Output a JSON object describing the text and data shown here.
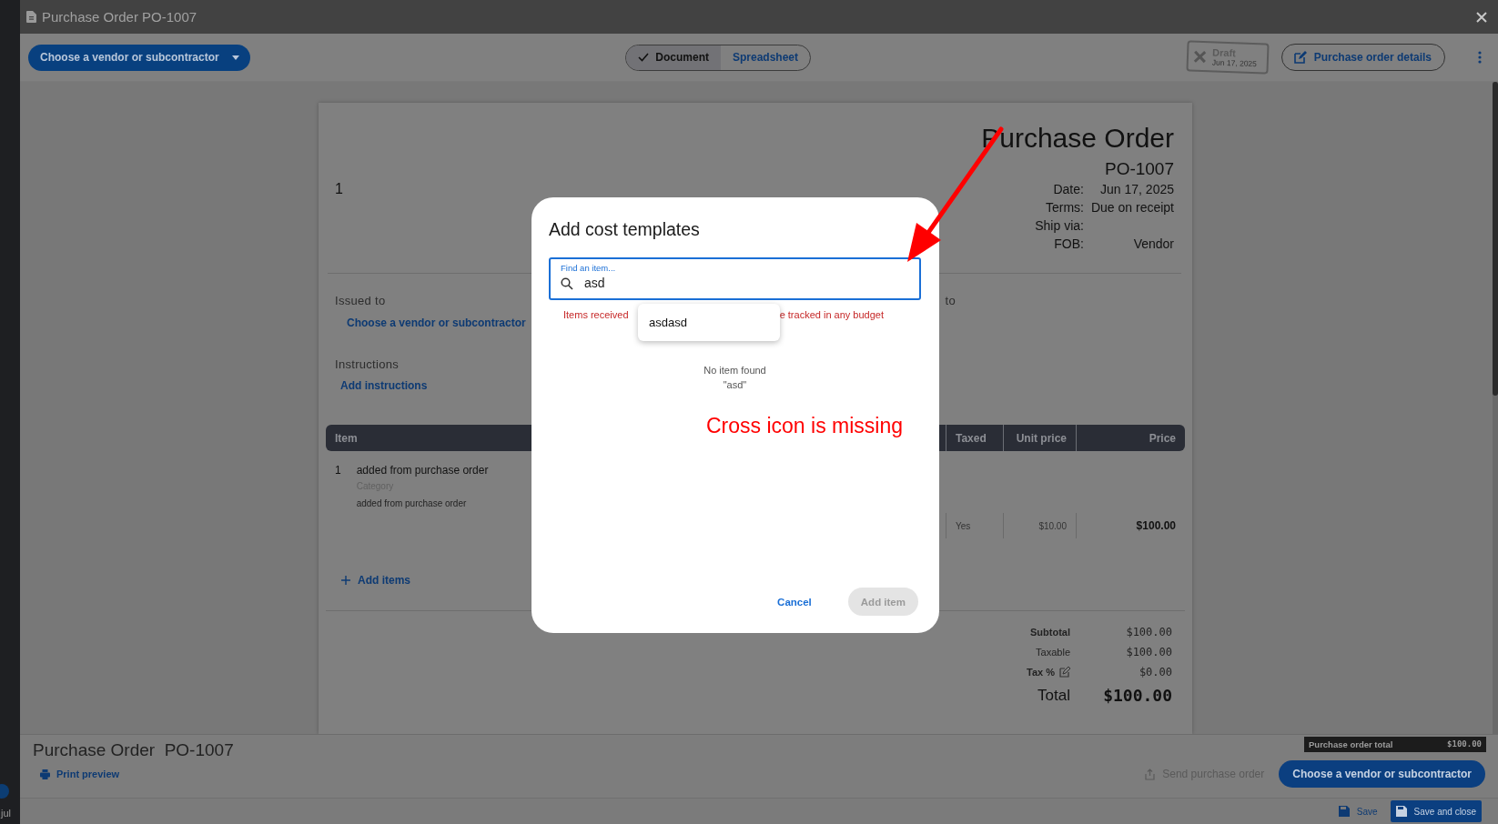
{
  "window": {
    "title": "Purchase Order PO-1007"
  },
  "rail": {
    "user_label": "jul"
  },
  "toolbar": {
    "vendor_button": "Choose a vendor or subcontractor",
    "view_toggle": [
      {
        "label": "Document",
        "selected": true
      },
      {
        "label": "Spreadsheet",
        "selected": false
      }
    ],
    "stamp": {
      "status": "Draft",
      "date": "Jun 17, 2025"
    },
    "details_button": "Purchase order details"
  },
  "document": {
    "number_field": "1",
    "title": "Purchase Order",
    "po_number": "PO-1007",
    "meta": [
      {
        "label": "Date:",
        "value": "Jun 17, 2025"
      },
      {
        "label": "Terms:",
        "value": "Due on receipt"
      },
      {
        "label": "Ship via:"
      },
      {
        "label": "FOB:",
        "value": "Vendor"
      }
    ],
    "issued_to": {
      "heading": "Issued to",
      "link": "Choose a vendor or subcontractor"
    },
    "ship_to_heading": "to",
    "instructions": {
      "heading": "Instructions",
      "link": "Add instructions"
    },
    "table": {
      "columns": [
        "Item",
        "Taxed",
        "Unit price",
        "Price"
      ],
      "rows": [
        {
          "number": "1",
          "item": "added from purchase order",
          "category": "Category",
          "description": "added from purchase order",
          "taxed": "Yes",
          "unit_price": "$10.00",
          "price": "$100.00"
        }
      ]
    },
    "add_items": "Add items",
    "totals": [
      {
        "label": "Subtotal",
        "value": "$100.00",
        "kind": "plain"
      },
      {
        "label": "Taxable",
        "value": "$100.00",
        "kind": "plain"
      },
      {
        "label": "Tax %",
        "value": "$0.00",
        "kind": "editable"
      },
      {
        "label": "Total",
        "value": "$100.00",
        "kind": "grand"
      }
    ]
  },
  "bottom_bar": {
    "title": "Purchase Order  PO-1007",
    "print_preview": "Print preview",
    "total_label": "Purchase order total",
    "total_value": "$100.00",
    "send": "Send purchase order",
    "vendor_button": "Choose a vendor or subcontractor",
    "save": "Save",
    "save_close": "Save and close"
  },
  "dialog": {
    "title": "Add cost templates",
    "search": {
      "label": "Find an item...",
      "value": "asd"
    },
    "helper_parts": [
      "Items received",
      "e tracked in any budget"
    ],
    "suggestion": "asdasd",
    "empty": [
      "No item found",
      "\"asd\""
    ],
    "annotation": "Cross icon is missing",
    "buttons": [
      {
        "label": "Cancel",
        "kind": "text",
        "disabled": false
      },
      {
        "label": "Add item",
        "kind": "filled",
        "disabled": true
      }
    ]
  }
}
